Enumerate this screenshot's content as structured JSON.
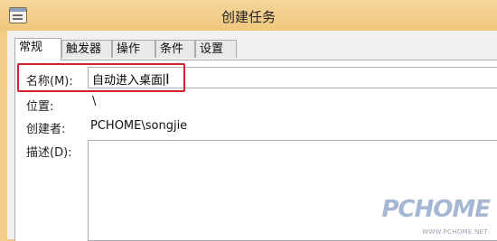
{
  "window": {
    "title": "创建任务"
  },
  "tabs": [
    {
      "label": "常规",
      "active": true
    },
    {
      "label": "触发器",
      "active": false
    },
    {
      "label": "操作",
      "active": false
    },
    {
      "label": "条件",
      "active": false
    },
    {
      "label": "设置",
      "active": false
    }
  ],
  "form": {
    "name_label": "名称(M):",
    "name_value": "自动进入桌面",
    "location_label": "位置:",
    "location_value": "\\",
    "author_label": "创建者:",
    "author_value": "PCHOME\\songjie",
    "description_label": "描述(D):",
    "description_value": ""
  },
  "watermark": {
    "text": "PCHOME",
    "url": "WWW.PCHOME.NET"
  },
  "colors": {
    "titlebar": "#f0c77e",
    "highlight": "#d2222b"
  }
}
